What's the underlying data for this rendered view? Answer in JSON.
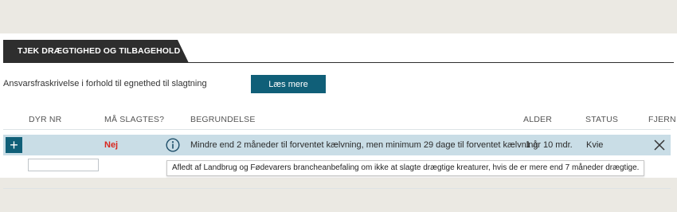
{
  "tab": {
    "title": "TJEK DRÆGTIGHED OG TILBAGEHOLD"
  },
  "disclaimer": {
    "text": "Ansvarsfraskrivelse i forhold til egnethed til slagtning",
    "button_label": "Læs mere"
  },
  "table": {
    "headers": {
      "dyr_nr": "DYR NR",
      "maa_slagtes": "MÅ SLAGTES?",
      "begrundelse": "BEGRUNDELSE",
      "alder": "ALDER",
      "status": "STATUS",
      "fjern": "FJERN"
    },
    "rows": [
      {
        "add_icon": "plus-icon",
        "maa_slagtes": "Nej",
        "info_icon": "info-icon",
        "begrundelse": "Mindre end 2 måneder til forventet kælvning, men minimum 29 dage til forventet kælvning",
        "alder": "1 år 10 mdr.",
        "status": "Kvie",
        "remove_icon": "close-icon"
      }
    ],
    "new_row": {
      "dyr_nr_value": ""
    }
  },
  "tooltip": {
    "text": "Afledt af Landbrug og Fødevarers brancheanbefaling om ikke at slagte drægtige kreaturer, hvis de er mere end 7 måneder drægtige."
  },
  "colors": {
    "accent": "#105f78",
    "tab_bg": "#2e2e2e",
    "row_highlight": "#c9dde6",
    "negative": "#d9271e",
    "page_bg": "#ebe9e3"
  }
}
